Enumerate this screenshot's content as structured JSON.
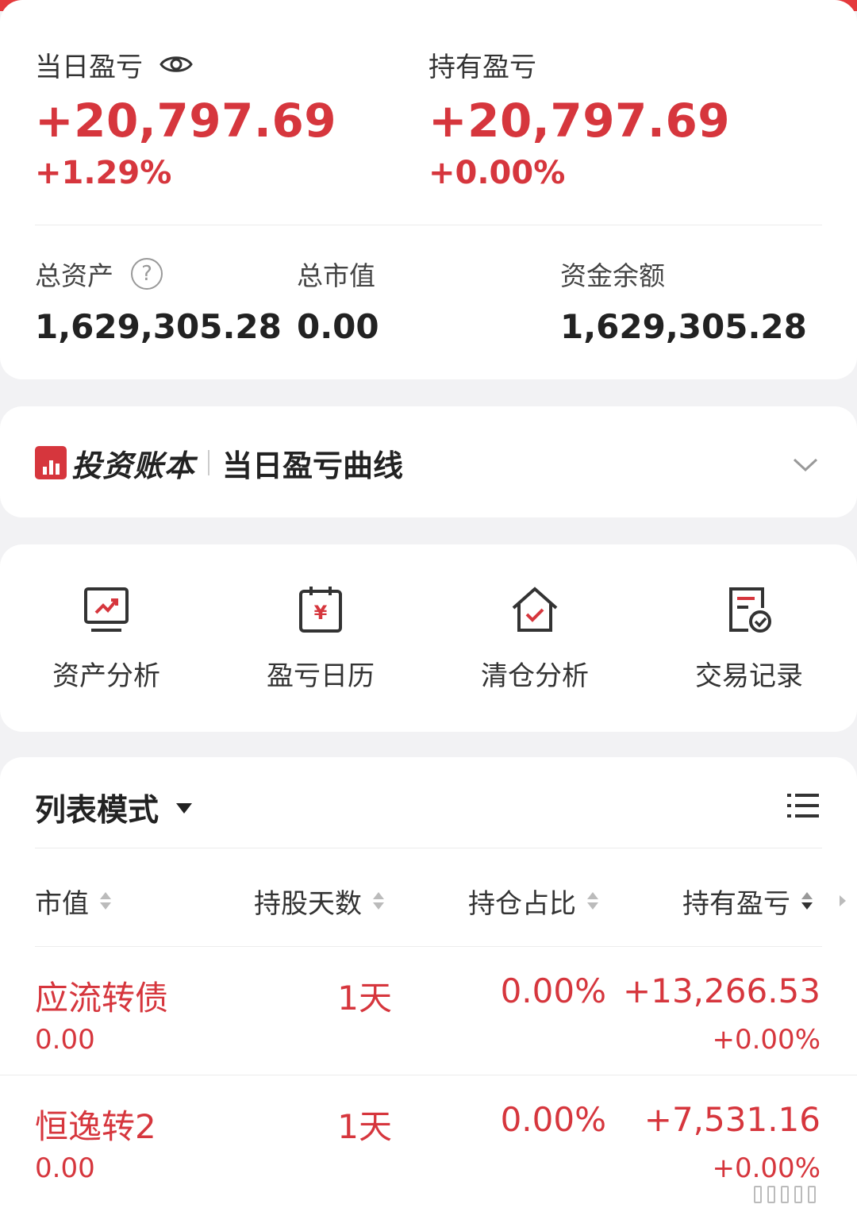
{
  "summary": {
    "daily_pnl": {
      "label": "当日盈亏",
      "amount": "+20,797.69",
      "percent": "+1.29%"
    },
    "holding_pnl": {
      "label": "持有盈亏",
      "amount": "+20,797.69",
      "percent": "+0.00%"
    },
    "total_assets": {
      "label": "总资产",
      "value": "1,629,305.28"
    },
    "market_value": {
      "label": "总市值",
      "value": "0.00"
    },
    "cash_balance": {
      "label": "资金余额",
      "value": "1,629,305.28"
    },
    "help_icon": "?"
  },
  "ledger": {
    "brand": "投资账本",
    "title": "当日盈亏曲线"
  },
  "tools": [
    {
      "label": "资产分析",
      "icon": "chart-monitor-icon"
    },
    {
      "label": "盈亏日历",
      "icon": "yen-calendar-icon"
    },
    {
      "label": "清仓分析",
      "icon": "house-check-icon"
    },
    {
      "label": "交易记录",
      "icon": "document-check-icon"
    }
  ],
  "list": {
    "mode_label": "列表模式",
    "columns": [
      "市值",
      "持股天数",
      "持仓占比",
      "持有盈亏"
    ],
    "rows": [
      {
        "name": "应流转债",
        "market_value": "0.00",
        "days": "1天",
        "ratio": "0.00%",
        "pnl": "+13,266.53",
        "pnl_pct": "+0.00%"
      },
      {
        "name": "恒逸转2",
        "market_value": "0.00",
        "days": "1天",
        "ratio": "0.00%",
        "pnl": "+7,531.16",
        "pnl_pct": "+0.00%"
      }
    ]
  },
  "colors": {
    "profit": "#d6363d",
    "brand_red": "#e4393c",
    "background": "#f2f2f4"
  }
}
